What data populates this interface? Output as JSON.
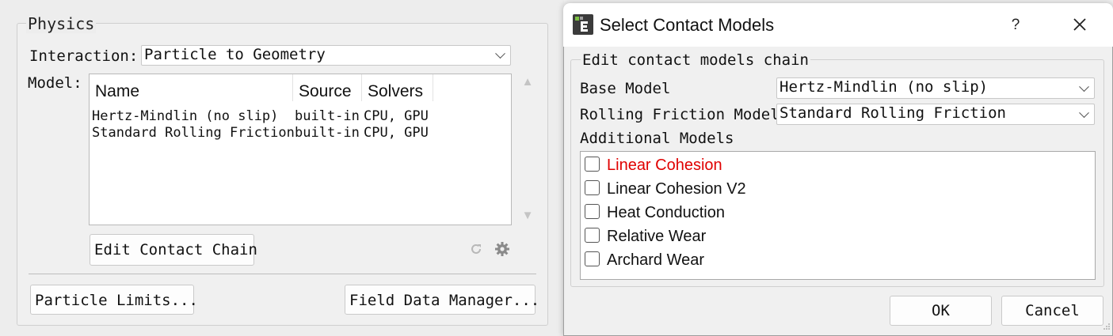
{
  "physics": {
    "title": "Physics",
    "interaction_label": "Interaction:",
    "interaction_value": "Particle to Geometry",
    "model_label": "Model:",
    "table": {
      "columns": [
        "Name",
        "Source",
        "Solvers"
      ],
      "rows": [
        [
          "Hertz-Mindlin (no slip)",
          "built-in",
          "CPU, GPU"
        ],
        [
          "Standard Rolling Friction",
          "built-in",
          "CPU, GPU"
        ]
      ]
    },
    "edit_chain_label": "Edit Contact Chain",
    "particle_limits_label": "Particle Limits...",
    "field_data_label": "Field Data Manager..."
  },
  "dialog": {
    "title": "Select Contact Models",
    "help_label": "?",
    "group_title": "Edit contact models chain",
    "base_model_label": "Base Model",
    "base_model_value": "Hertz-Mindlin (no slip)",
    "rolling_label": "Rolling Friction Model",
    "rolling_value": "Standard Rolling Friction",
    "additional_label": "Additional Models",
    "additional_models": [
      {
        "label": "Linear Cohesion",
        "checked": false,
        "color": "#e00000"
      },
      {
        "label": "Linear Cohesion V2",
        "checked": false,
        "color": "#111111"
      },
      {
        "label": "Heat Conduction",
        "checked": false,
        "color": "#111111"
      },
      {
        "label": "Relative Wear",
        "checked": false,
        "color": "#111111"
      },
      {
        "label": "Archard Wear",
        "checked": false,
        "color": "#111111"
      }
    ],
    "ok_label": "OK",
    "cancel_label": "Cancel"
  }
}
